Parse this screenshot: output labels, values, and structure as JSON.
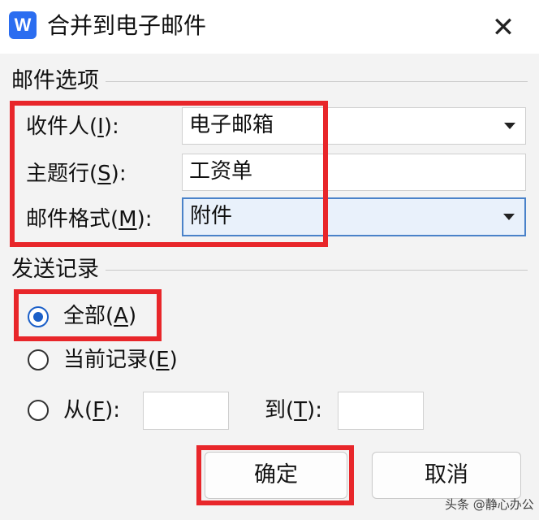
{
  "window": {
    "app_icon_text": "W",
    "title": "合并到电子邮件",
    "close_symbol": "✕"
  },
  "mail_options": {
    "group_label": "邮件选项",
    "recipient": {
      "label_pre": "收件人(",
      "label_key": "I",
      "label_post": "):",
      "value": "电子邮箱"
    },
    "subject": {
      "label_pre": "主题行(",
      "label_key": "S",
      "label_post": "):",
      "value": "工资单"
    },
    "format": {
      "label_pre": "邮件格式(",
      "label_key": "M",
      "label_post": "):",
      "value": "附件"
    }
  },
  "send_records": {
    "group_label": "发送记录",
    "all": {
      "label_pre": "全部(",
      "label_key": "A",
      "label_post": ")",
      "checked": true
    },
    "current": {
      "label_pre": "当前记录(",
      "label_key": "E",
      "label_post": ")",
      "checked": false
    },
    "range": {
      "from_pre": "从(",
      "from_key": "F",
      "from_post": "):",
      "to_pre": "到(",
      "to_key": "T",
      "to_post": "):",
      "from_value": "",
      "to_value": "",
      "checked": false
    }
  },
  "buttons": {
    "ok": "确定",
    "cancel": "取消"
  },
  "watermark": "头条 @静心办公",
  "colors": {
    "highlight": "#e8262a",
    "accent": "#1b5fc8",
    "app_icon": "#2b6df0"
  }
}
